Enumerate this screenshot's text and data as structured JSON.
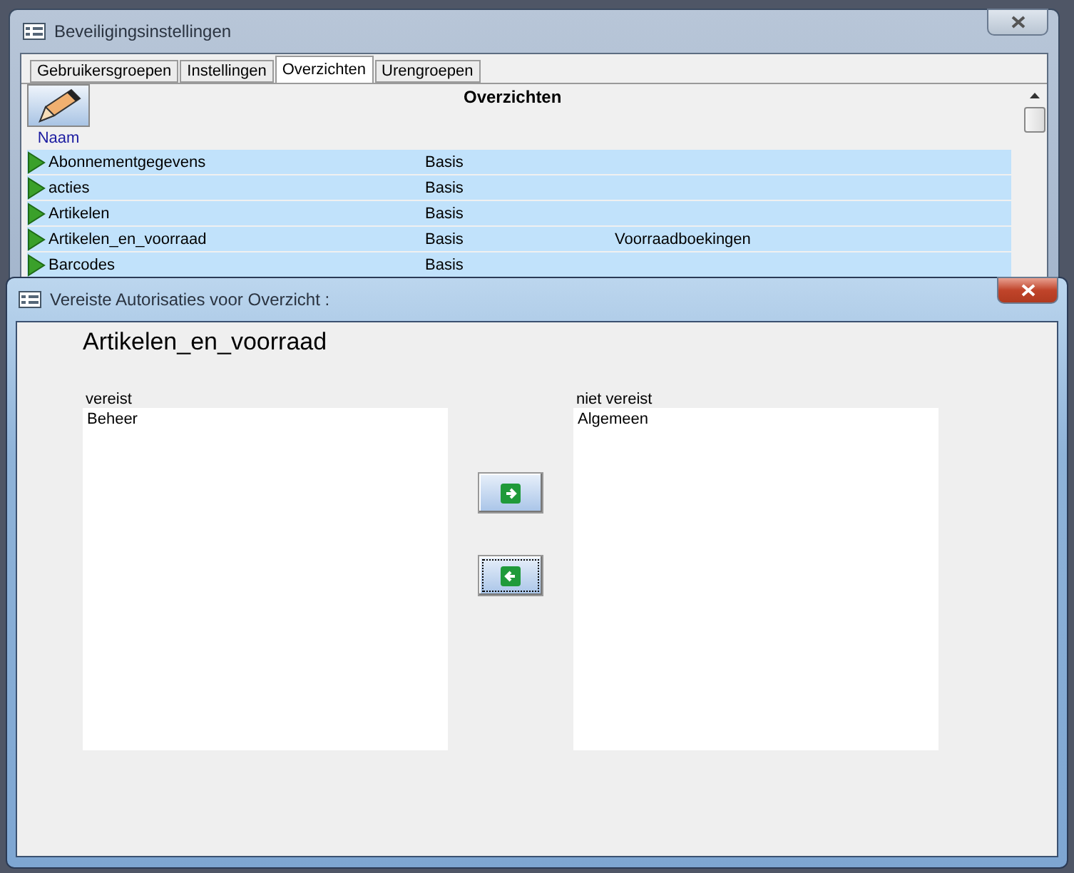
{
  "window": {
    "title": "Beveiligingsinstellingen"
  },
  "tabs": [
    {
      "label": "Gebruikersgroepen",
      "selected": false
    },
    {
      "label": "Instellingen",
      "selected": false
    },
    {
      "label": "Overzichten",
      "selected": true
    },
    {
      "label": "Urengroepen",
      "selected": false
    }
  ],
  "section_title": "Overzichten",
  "column_header": "Naam",
  "rows": [
    {
      "name": "Abonnementgegevens",
      "group": "Basis"
    },
    {
      "name": "acties",
      "group": "Basis"
    },
    {
      "name": "Artikelen",
      "group": "Basis"
    },
    {
      "name": "Artikelen_en_voorraad",
      "group": "Basis",
      "column_3": "Voorraadboekingen"
    },
    {
      "name": "Barcodes",
      "group": "Basis"
    }
  ],
  "dialog": {
    "title": "Vereiste Autorisaties voor Overzicht :",
    "heading": "Artikelen_en_voorraad",
    "lists": [
      {
        "label": "vereist",
        "items": [
          "Beheer"
        ]
      },
      {
        "label": "niet vereist",
        "items": [
          "Algemeen"
        ]
      }
    ],
    "buttons": [
      {
        "kind": "right",
        "focused": false
      },
      {
        "kind": "left",
        "focused": true
      }
    ]
  }
}
